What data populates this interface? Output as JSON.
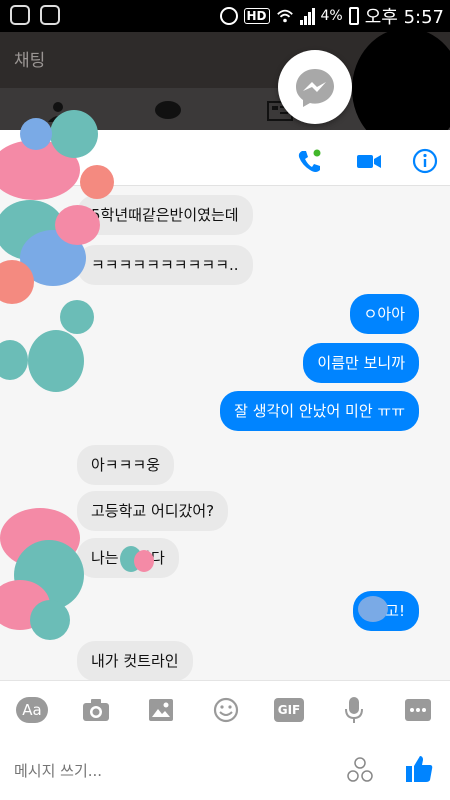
{
  "status_bar": {
    "battery_pct": "4%",
    "time": "오후 5:57",
    "hd_label": "HD"
  },
  "app_header": {
    "title": "채팅"
  },
  "thread": {
    "messages": [
      {
        "dir": "in",
        "text": "5학년때같은반이였는데"
      },
      {
        "dir": "in",
        "text": "ㅋㅋㅋㅋㅋㅋㅋㅋㅋㅋ.."
      },
      {
        "dir": "out",
        "text": "ㅇ아아"
      },
      {
        "dir": "out",
        "text": "이름만 보니까"
      },
      {
        "dir": "out",
        "text": "잘 생각이 안났어 미안 ㅠㅠ"
      },
      {
        "dir": "in",
        "text": "아ㅋㅋㅋ웅"
      },
      {
        "dir": "in",
        "text": "고등학교 어디갔어?"
      },
      {
        "dir": "in",
        "text": "나는 고갔다"
      },
      {
        "dir": "out",
        "text": "나 고!"
      },
      {
        "dir": "in",
        "text": "내가 컷트라인"
      }
    ]
  },
  "toolbar": {
    "text_label": "Aa",
    "gif_label": "GIF"
  },
  "composer": {
    "placeholder": "메시지 쓰기..."
  },
  "colors": {
    "accent": "#0084ff",
    "incoming_bubble": "#e9e9e9",
    "dim_header": "#2e2b2a"
  }
}
